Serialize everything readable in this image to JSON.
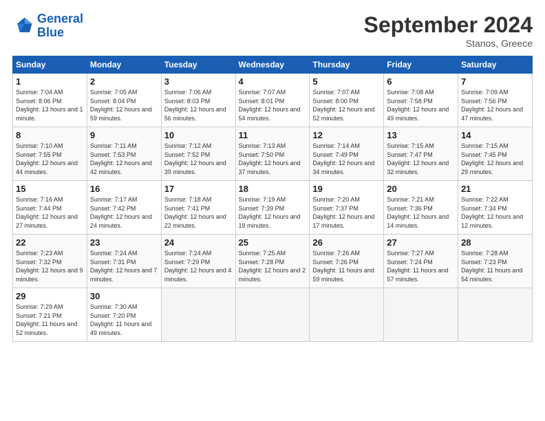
{
  "header": {
    "logo_line1": "General",
    "logo_line2": "Blue",
    "month_title": "September 2024",
    "location": "Stanos, Greece"
  },
  "weekdays": [
    "Sunday",
    "Monday",
    "Tuesday",
    "Wednesday",
    "Thursday",
    "Friday",
    "Saturday"
  ],
  "weeks": [
    [
      {
        "day": "1",
        "sunrise": "Sunrise: 7:04 AM",
        "sunset": "Sunset: 8:06 PM",
        "daylight": "Daylight: 13 hours and 1 minute."
      },
      {
        "day": "2",
        "sunrise": "Sunrise: 7:05 AM",
        "sunset": "Sunset: 8:04 PM",
        "daylight": "Daylight: 12 hours and 59 minutes."
      },
      {
        "day": "3",
        "sunrise": "Sunrise: 7:06 AM",
        "sunset": "Sunset: 8:03 PM",
        "daylight": "Daylight: 12 hours and 56 minutes."
      },
      {
        "day": "4",
        "sunrise": "Sunrise: 7:07 AM",
        "sunset": "Sunset: 8:01 PM",
        "daylight": "Daylight: 12 hours and 54 minutes."
      },
      {
        "day": "5",
        "sunrise": "Sunrise: 7:07 AM",
        "sunset": "Sunset: 8:00 PM",
        "daylight": "Daylight: 12 hours and 52 minutes."
      },
      {
        "day": "6",
        "sunrise": "Sunrise: 7:08 AM",
        "sunset": "Sunset: 7:58 PM",
        "daylight": "Daylight: 12 hours and 49 minutes."
      },
      {
        "day": "7",
        "sunrise": "Sunrise: 7:09 AM",
        "sunset": "Sunset: 7:56 PM",
        "daylight": "Daylight: 12 hours and 47 minutes."
      }
    ],
    [
      {
        "day": "8",
        "sunrise": "Sunrise: 7:10 AM",
        "sunset": "Sunset: 7:55 PM",
        "daylight": "Daylight: 12 hours and 44 minutes."
      },
      {
        "day": "9",
        "sunrise": "Sunrise: 7:11 AM",
        "sunset": "Sunset: 7:53 PM",
        "daylight": "Daylight: 12 hours and 42 minutes."
      },
      {
        "day": "10",
        "sunrise": "Sunrise: 7:12 AM",
        "sunset": "Sunset: 7:52 PM",
        "daylight": "Daylight: 12 hours and 39 minutes."
      },
      {
        "day": "11",
        "sunrise": "Sunrise: 7:13 AM",
        "sunset": "Sunset: 7:50 PM",
        "daylight": "Daylight: 12 hours and 37 minutes."
      },
      {
        "day": "12",
        "sunrise": "Sunrise: 7:14 AM",
        "sunset": "Sunset: 7:49 PM",
        "daylight": "Daylight: 12 hours and 34 minutes."
      },
      {
        "day": "13",
        "sunrise": "Sunrise: 7:15 AM",
        "sunset": "Sunset: 7:47 PM",
        "daylight": "Daylight: 12 hours and 32 minutes."
      },
      {
        "day": "14",
        "sunrise": "Sunrise: 7:15 AM",
        "sunset": "Sunset: 7:45 PM",
        "daylight": "Daylight: 12 hours and 29 minutes."
      }
    ],
    [
      {
        "day": "15",
        "sunrise": "Sunrise: 7:16 AM",
        "sunset": "Sunset: 7:44 PM",
        "daylight": "Daylight: 12 hours and 27 minutes."
      },
      {
        "day": "16",
        "sunrise": "Sunrise: 7:17 AM",
        "sunset": "Sunset: 7:42 PM",
        "daylight": "Daylight: 12 hours and 24 minutes."
      },
      {
        "day": "17",
        "sunrise": "Sunrise: 7:18 AM",
        "sunset": "Sunset: 7:41 PM",
        "daylight": "Daylight: 12 hours and 22 minutes."
      },
      {
        "day": "18",
        "sunrise": "Sunrise: 7:19 AM",
        "sunset": "Sunset: 7:39 PM",
        "daylight": "Daylight: 12 hours and 19 minutes."
      },
      {
        "day": "19",
        "sunrise": "Sunrise: 7:20 AM",
        "sunset": "Sunset: 7:37 PM",
        "daylight": "Daylight: 12 hours and 17 minutes."
      },
      {
        "day": "20",
        "sunrise": "Sunrise: 7:21 AM",
        "sunset": "Sunset: 7:36 PM",
        "daylight": "Daylight: 12 hours and 14 minutes."
      },
      {
        "day": "21",
        "sunrise": "Sunrise: 7:22 AM",
        "sunset": "Sunset: 7:34 PM",
        "daylight": "Daylight: 12 hours and 12 minutes."
      }
    ],
    [
      {
        "day": "22",
        "sunrise": "Sunrise: 7:23 AM",
        "sunset": "Sunset: 7:32 PM",
        "daylight": "Daylight: 12 hours and 9 minutes."
      },
      {
        "day": "23",
        "sunrise": "Sunrise: 7:24 AM",
        "sunset": "Sunset: 7:31 PM",
        "daylight": "Daylight: 12 hours and 7 minutes."
      },
      {
        "day": "24",
        "sunrise": "Sunrise: 7:24 AM",
        "sunset": "Sunset: 7:29 PM",
        "daylight": "Daylight: 12 hours and 4 minutes."
      },
      {
        "day": "25",
        "sunrise": "Sunrise: 7:25 AM",
        "sunset": "Sunset: 7:28 PM",
        "daylight": "Daylight: 12 hours and 2 minutes."
      },
      {
        "day": "26",
        "sunrise": "Sunrise: 7:26 AM",
        "sunset": "Sunset: 7:26 PM",
        "daylight": "Daylight: 11 hours and 59 minutes."
      },
      {
        "day": "27",
        "sunrise": "Sunrise: 7:27 AM",
        "sunset": "Sunset: 7:24 PM",
        "daylight": "Daylight: 11 hours and 57 minutes."
      },
      {
        "day": "28",
        "sunrise": "Sunrise: 7:28 AM",
        "sunset": "Sunset: 7:23 PM",
        "daylight": "Daylight: 11 hours and 54 minutes."
      }
    ],
    [
      {
        "day": "29",
        "sunrise": "Sunrise: 7:29 AM",
        "sunset": "Sunset: 7:21 PM",
        "daylight": "Daylight: 11 hours and 52 minutes."
      },
      {
        "day": "30",
        "sunrise": "Sunrise: 7:30 AM",
        "sunset": "Sunset: 7:20 PM",
        "daylight": "Daylight: 11 hours and 49 minutes."
      },
      null,
      null,
      null,
      null,
      null
    ]
  ]
}
